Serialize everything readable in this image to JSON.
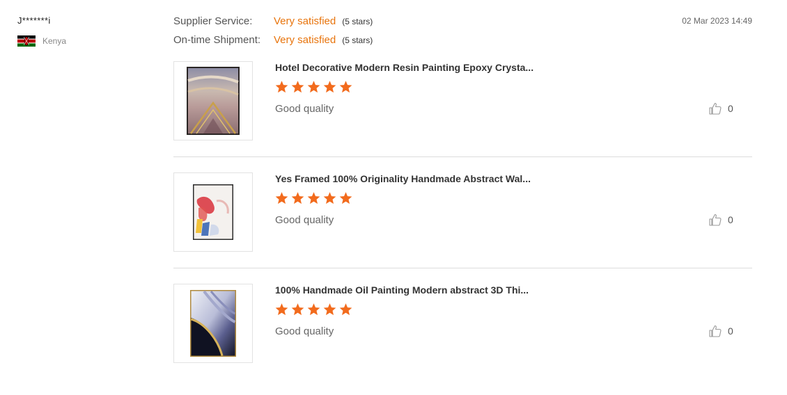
{
  "reviewer": {
    "name": "J*******i",
    "country": "Kenya",
    "flag_icon": "kenya-flag-icon"
  },
  "ratings": [
    {
      "label": "Supplier Service:",
      "value": "Very satisfied",
      "stars_text": "(5 stars)"
    },
    {
      "label": "On-time Shipment:",
      "value": "Very satisfied",
      "stars_text": "(5 stars)"
    }
  ],
  "date": "02 Mar 2023 14:49",
  "products": [
    {
      "title": "Hotel Decorative Modern Resin Painting Epoxy Crysta...",
      "rating": 5,
      "comment": "Good quality",
      "likes": "0",
      "thumb_icon": "resin-painting-thumbnail"
    },
    {
      "title": "Yes Framed 100% Originality Handmade Abstract Wal...",
      "rating": 5,
      "comment": "Good quality",
      "likes": "0",
      "thumb_icon": "abstract-painting-thumbnail"
    },
    {
      "title": "100% Handmade Oil Painting Modern abstract 3D Thi...",
      "rating": 5,
      "comment": "Good quality",
      "likes": "0",
      "thumb_icon": "oil-painting-thumbnail"
    }
  ],
  "colors": {
    "accent": "#e8740c",
    "star": "#f26b1d",
    "divider": "#dddddd"
  },
  "icons": {
    "star": "star-icon",
    "like": "thumbs-up-icon"
  }
}
